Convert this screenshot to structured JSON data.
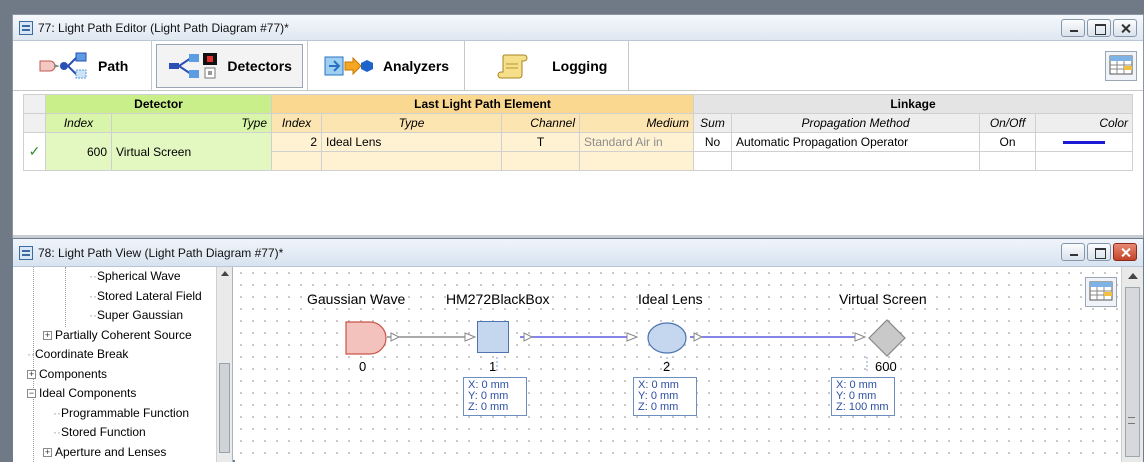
{
  "editor": {
    "title": "77: Light Path Editor (Light Path Diagram #77)*",
    "tabs": [
      {
        "label": "Path"
      },
      {
        "label": "Detectors"
      },
      {
        "label": "Analyzers"
      },
      {
        "label": "Logging"
      }
    ],
    "groups": {
      "detector": "Detector",
      "last_element": "Last Light Path Element",
      "linkage": "Linkage"
    },
    "columns": {
      "index": "Index",
      "type": "Type",
      "lle_index": "Index",
      "lle_type": "Type",
      "channel": "Channel",
      "medium": "Medium",
      "sum": "Sum",
      "propagation": "Propagation Method",
      "onoff": "On/Off",
      "color": "Color"
    },
    "row": {
      "checked": "✓",
      "index": "600",
      "type": "Virtual Screen",
      "lle_index": "2",
      "lle_type": "Ideal Lens",
      "channel": "T",
      "medium": "Standard Air in",
      "sum": "No",
      "propagation": "Automatic Propagation Operator",
      "onoff": "On",
      "color": "#1a1ad6"
    }
  },
  "view": {
    "title": "78: Light Path View (Light Path Diagram #77)*",
    "tree": [
      "Spherical Wave",
      "Stored Lateral Field",
      "Super Gaussian",
      "Partially Coherent Source",
      "Coordinate Break",
      "Components",
      "Ideal Components",
      "Programmable Function",
      "Stored Function",
      "Aperture and Lenses"
    ],
    "nodes": [
      {
        "name": "Gaussian Wave",
        "index": "0"
      },
      {
        "name": "HM272BlackBox",
        "index": "1",
        "coords": [
          "X: 0 mm",
          "Y: 0 mm",
          "Z: 0 mm"
        ]
      },
      {
        "name": "Ideal Lens",
        "index": "2",
        "coords": [
          "X: 0 mm",
          "Y: 0 mm",
          "Z: 0 mm"
        ]
      },
      {
        "name": "Virtual Screen",
        "index": "600",
        "coords": [
          "X: 0 mm",
          "Y: 0 mm",
          "Z: 100 mm"
        ]
      }
    ]
  }
}
